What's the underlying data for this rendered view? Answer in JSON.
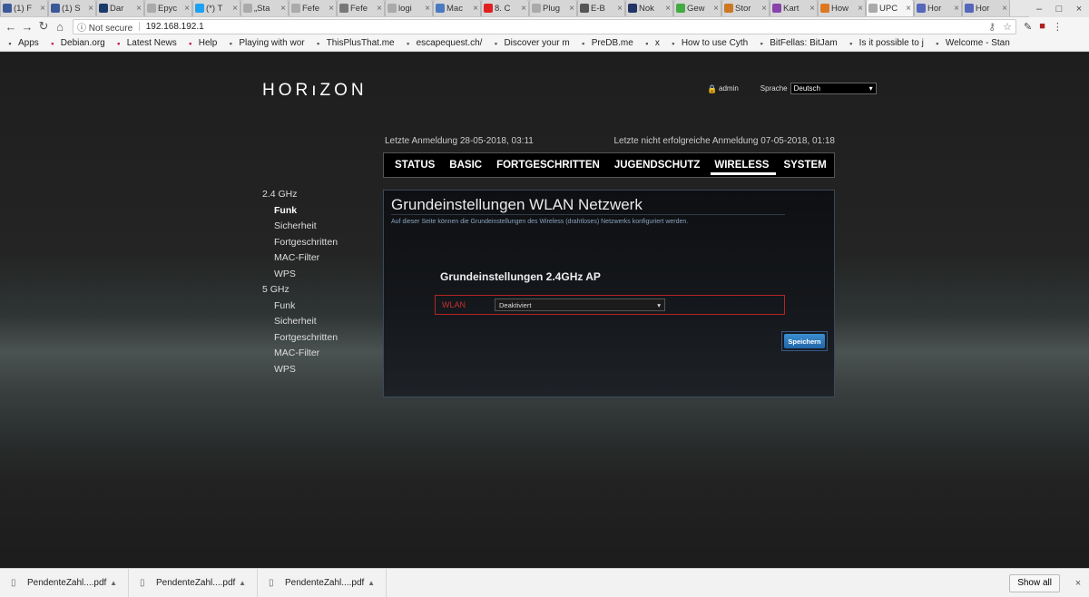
{
  "browser": {
    "tabs": [
      {
        "label": "(1) F",
        "icon": "facebook-icon",
        "color": "#3b5998"
      },
      {
        "label": "(1) S",
        "icon": "facebook-icon",
        "color": "#3b5998"
      },
      {
        "label": "Dar",
        "icon": "sn-icon",
        "color": "#1a3a6a"
      },
      {
        "label": "Epyc",
        "icon": "page-icon",
        "color": "#aaaaaa"
      },
      {
        "label": "(*) T",
        "icon": "twitter-icon",
        "color": "#1da1f2"
      },
      {
        "label": "„Sta",
        "icon": "page-icon",
        "color": "#aaaaaa"
      },
      {
        "label": "Fefe",
        "icon": "page-icon",
        "color": "#aaaaaa"
      },
      {
        "label": "Fefe",
        "icon": "gear-icon",
        "color": "#777777"
      },
      {
        "label": "logi",
        "icon": "page-icon",
        "color": "#aaaaaa"
      },
      {
        "label": "Mac",
        "icon": "link-icon",
        "color": "#4a7ac0"
      },
      {
        "label": "8. C",
        "icon": "youtube-icon",
        "color": "#e02020"
      },
      {
        "label": "Plug",
        "icon": "page-icon",
        "color": "#aaaaaa"
      },
      {
        "label": "E-B",
        "icon": "gear-icon",
        "color": "#555555"
      },
      {
        "label": "Nok",
        "icon": "n-icon",
        "color": "#223366"
      },
      {
        "label": "Gew",
        "icon": "globe-icon",
        "color": "#44aa44"
      },
      {
        "label": "Stor",
        "icon": "thumb-icon",
        "color": "#cc7722"
      },
      {
        "label": "Kart",
        "icon": "map-icon",
        "color": "#8844aa"
      },
      {
        "label": "How",
        "icon": "page-icon",
        "color": "#dd7722"
      },
      {
        "label": "UPC",
        "icon": "page-icon",
        "color": "#aaaaaa",
        "active": true
      },
      {
        "label": "Hor",
        "icon": "globe-icon",
        "color": "#5566bb"
      },
      {
        "label": "Hor",
        "icon": "globe-icon",
        "color": "#5566bb"
      }
    ],
    "tab_close": "×",
    "security": "Not secure",
    "url": "192.168.192.1",
    "bookmarks": [
      {
        "label": "Apps",
        "icon": "apps-icon"
      },
      {
        "label": "Debian.org",
        "icon": "debian-icon"
      },
      {
        "label": "Latest News",
        "icon": "debian-icon"
      },
      {
        "label": "Help",
        "icon": "debian-icon"
      },
      {
        "label": "Playing with wor",
        "icon": "page-icon"
      },
      {
        "label": "ThisPlusThat.me",
        "icon": "thisplusthat-icon"
      },
      {
        "label": "escapequest.ch/",
        "icon": "escape-icon"
      },
      {
        "label": "Discover your m",
        "icon": "rocket-icon"
      },
      {
        "label": "PreDB.me",
        "icon": "page-icon"
      },
      {
        "label": "x",
        "icon": "wave-icon"
      },
      {
        "label": "How to use Cyth",
        "icon": "page-icon"
      },
      {
        "label": "BitFellas: BitJam",
        "icon": "page-icon"
      },
      {
        "label": "Is it possible to j",
        "icon": "github-icon"
      },
      {
        "label": "Welcome - Stan",
        "icon": "link-icon"
      }
    ]
  },
  "header": {
    "logo": "HORıZON",
    "user": "admin",
    "language_label": "Sprache",
    "language_value": "Deutsch",
    "last_login": "Letzte Anmeldung 28-05-2018, 03:11",
    "last_failed_login": "Letzte nicht erfolgreiche Anmeldung 07-05-2018, 01:18"
  },
  "nav": [
    {
      "label": "STATUS"
    },
    {
      "label": "BASIC"
    },
    {
      "label": "FORTGESCHRITTEN"
    },
    {
      "label": "JUGENDSCHUTZ"
    },
    {
      "label": "WIRELESS",
      "active": true
    },
    {
      "label": "SYSTEM"
    }
  ],
  "sidebar": {
    "group1": "2.4 GHz",
    "group1_items": [
      "Funk",
      "Sicherheit",
      "Fortgeschritten",
      "MAC-Filter",
      "WPS"
    ],
    "group2": "5 GHz",
    "group2_items": [
      "Funk",
      "Sicherheit",
      "Fortgeschritten",
      "MAC-Filter",
      "WPS"
    ]
  },
  "panel": {
    "title": "Grundeinstellungen WLAN Netzwerk",
    "description": "Auf dieser Seite können die Grundeinstellungen des Wireless (drahtloses) Netzwerks konfiguriert werden.",
    "subtitle": "Grundeinstellungen 2.4GHz AP",
    "wlan_label": "WLAN",
    "wlan_value": "Deaktiviert",
    "save_label": "Speichern"
  },
  "downloads": {
    "items": [
      "PendenteZahl....pdf",
      "PendenteZahl....pdf",
      "PendenteZahl....pdf"
    ],
    "show_all": "Show all"
  }
}
